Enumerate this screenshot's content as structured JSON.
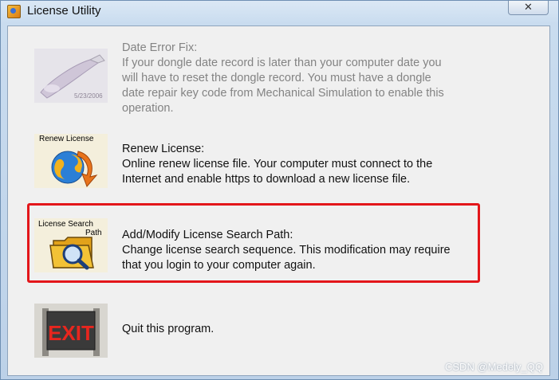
{
  "window": {
    "title": "License Utility",
    "close_glyph": "✕"
  },
  "options": [
    {
      "image_label": "",
      "image_text": "5/23/2006",
      "heading": "Date Error Fix:",
      "lines": [
        "If your dongle date record is later than your computer date you",
        "will have to reset the dongle record. You must have a dongle",
        "date repair key code from Mechanical Simulation to enable this",
        "operation."
      ],
      "enabled": false
    },
    {
      "image_label": "Renew License",
      "heading": "Renew License:",
      "lines": [
        "Online renew license file. Your computer must connect to the",
        "Internet and enable https to download a new license file."
      ],
      "enabled": true
    },
    {
      "image_label_1": "License Search",
      "image_label_2": "Path",
      "heading": "Add/Modify License Search Path:",
      "lines": [
        "Change license search sequence. This modification may require",
        "that you login to your computer again."
      ],
      "enabled": true,
      "highlighted": true
    },
    {
      "image_label": "EXIT",
      "heading": "Quit this program.",
      "lines": [],
      "enabled": true
    }
  ],
  "icons": [
    "usb-dongle-icon",
    "renew-license-globe-icon",
    "license-search-folder-icon",
    "exit-sign-icon",
    "app-icon",
    "close-icon"
  ],
  "colors": {
    "highlight": "#e3161a",
    "disabled_text": "#838383"
  },
  "watermark": "CSDN @Medely_QQ"
}
